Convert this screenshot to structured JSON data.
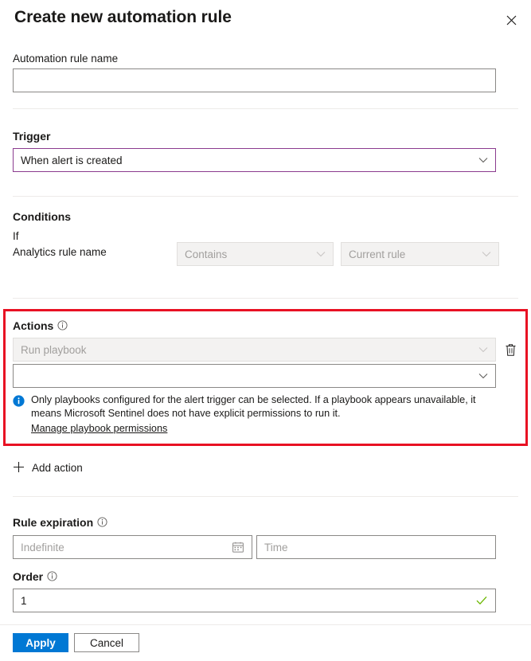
{
  "dialog": {
    "title": "Create new automation rule",
    "close_icon": "close-icon"
  },
  "name_section": {
    "label": "Automation rule name",
    "value": "",
    "placeholder": ""
  },
  "trigger_section": {
    "label": "Trigger",
    "selected": "When alert is created",
    "chevron_icon": "chevron-down-icon",
    "border_color": "#8b3b8f"
  },
  "conditions_section": {
    "label": "Conditions",
    "if_label": "If",
    "property_label": "Analytics rule name",
    "operator": {
      "value": "Contains",
      "disabled": true
    },
    "value": {
      "value": "Current rule",
      "disabled": true
    }
  },
  "actions_section": {
    "label": "Actions",
    "info_icon": "info-circle-icon",
    "highlight_color": "#e81123",
    "action_type": {
      "value": "Run playbook",
      "disabled": true
    },
    "playbook": {
      "value": "",
      "placeholder": ""
    },
    "delete_icon": "trash-icon",
    "notice": {
      "icon": "info-filled-icon",
      "text": "Only playbooks configured for the alert trigger can be selected. If a playbook appears unavailable, it means Microsoft Sentinel does not have explicit permissions to run it.",
      "link": "Manage playbook permissions",
      "link_color": "#0f5ba7"
    }
  },
  "add_action": {
    "label": "Add action",
    "icon": "plus-icon"
  },
  "expiration_section": {
    "label": "Rule expiration",
    "info_icon": "info-circle-icon",
    "date": {
      "value": "",
      "placeholder": "Indefinite",
      "icon": "calendar-icon"
    },
    "time": {
      "value": "",
      "placeholder": "Time"
    }
  },
  "order_section": {
    "label": "Order",
    "info_icon": "info-circle-icon",
    "value": "1",
    "valid_icon": "checkmark-icon",
    "valid_color": "#6bb700"
  },
  "footer": {
    "apply_label": "Apply",
    "cancel_label": "Cancel",
    "apply_color": "#0078d4"
  }
}
